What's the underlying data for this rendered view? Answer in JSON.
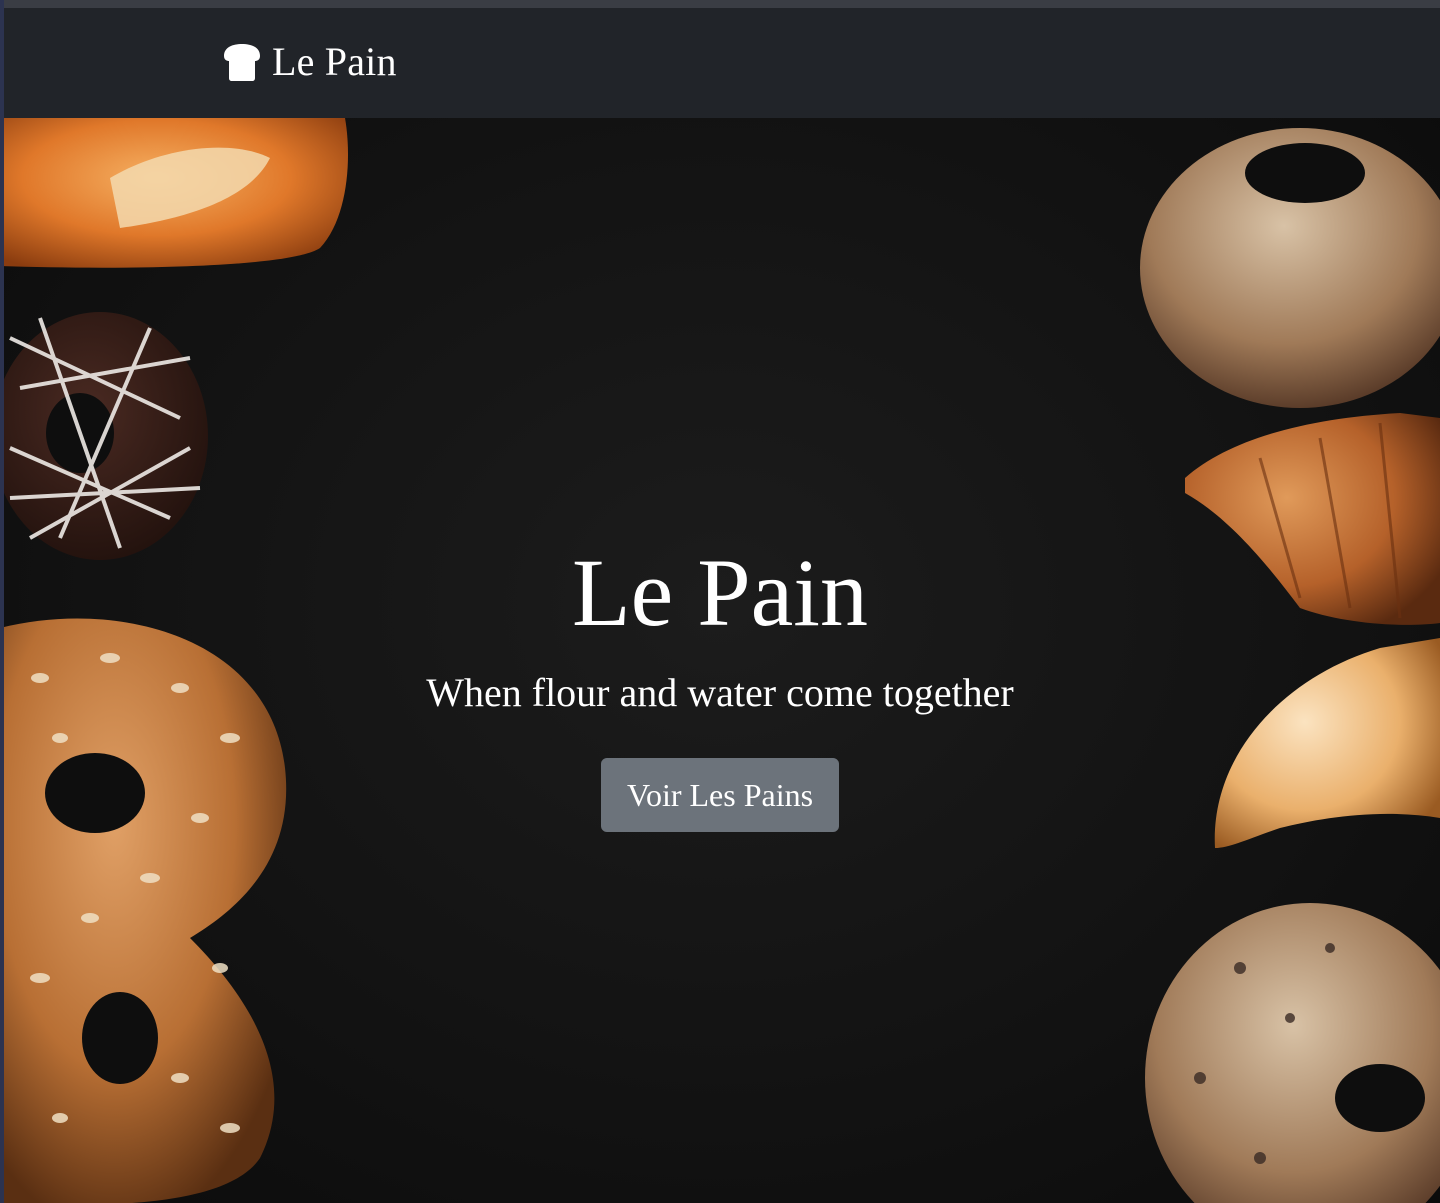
{
  "navbar": {
    "brand_icon": "bread-icon",
    "brand_label": "Le Pain"
  },
  "hero": {
    "title": "Le Pain",
    "subtitle": "When flour and water come together",
    "button_label": "Voir Les Pains",
    "background_image": "bread-pastries-on-black-background"
  },
  "colors": {
    "navbar_bg": "#212429",
    "hero_bg": "#131313",
    "button_bg": "#6c737b",
    "text": "#ffffff"
  }
}
